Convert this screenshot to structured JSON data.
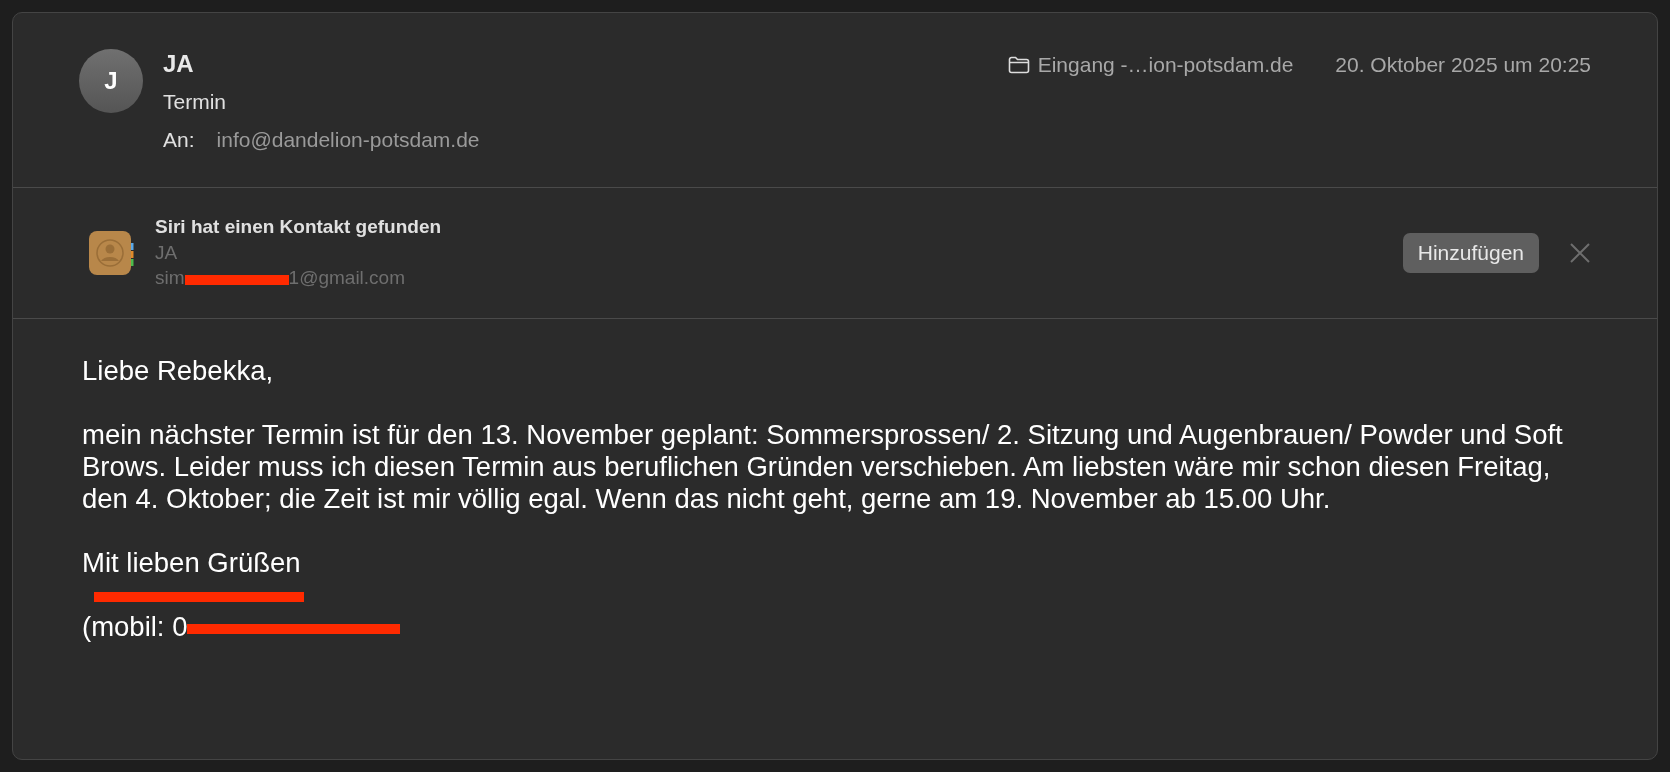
{
  "message": {
    "avatar_initial": "J",
    "sender": "JA",
    "subject": "Termin",
    "to_label": "An:",
    "to_address": "info@dandelion-potsdam.de",
    "mailbox": "Eingang -…ion-potsdam.de",
    "date": "20. Oktober 2025 um 20:25"
  },
  "siri_banner": {
    "title": "Siri hat einen Kontakt gefunden",
    "name": "JA",
    "email_parts": [
      {
        "kind": "text",
        "text": "sim"
      },
      {
        "kind": "redacted"
      },
      {
        "kind": "text",
        "text": "1@gmail.com"
      }
    ],
    "add_button": "Hinzufügen"
  },
  "body": {
    "paragraphs": [
      {
        "lines": [
          "Liebe Rebekka,"
        ]
      },
      {
        "lines": [
          "mein nächster Termin ist für den 13. November geplant: Sommersprossen/ 2. Sitzung und Augenbrauen/ Powder und Soft Brows. Leider muss ich diesen Termin aus beruflichen Gründen verschieben. Am liebsten wäre mir schon diesen Freitag, den 4. Oktober; die Zeit ist mir völlig egal. Wenn das nicht geht, gerne am 19. November ab 15.00 Uhr."
        ]
      },
      {
        "lines": [
          "Mit lieben Grüßen",
          [
            {
              "kind": "redacted"
            }
          ],
          [
            {
              "kind": "text",
              "text": "(mobil: 0"
            },
            {
              "kind": "redacted"
            }
          ]
        ]
      }
    ]
  }
}
